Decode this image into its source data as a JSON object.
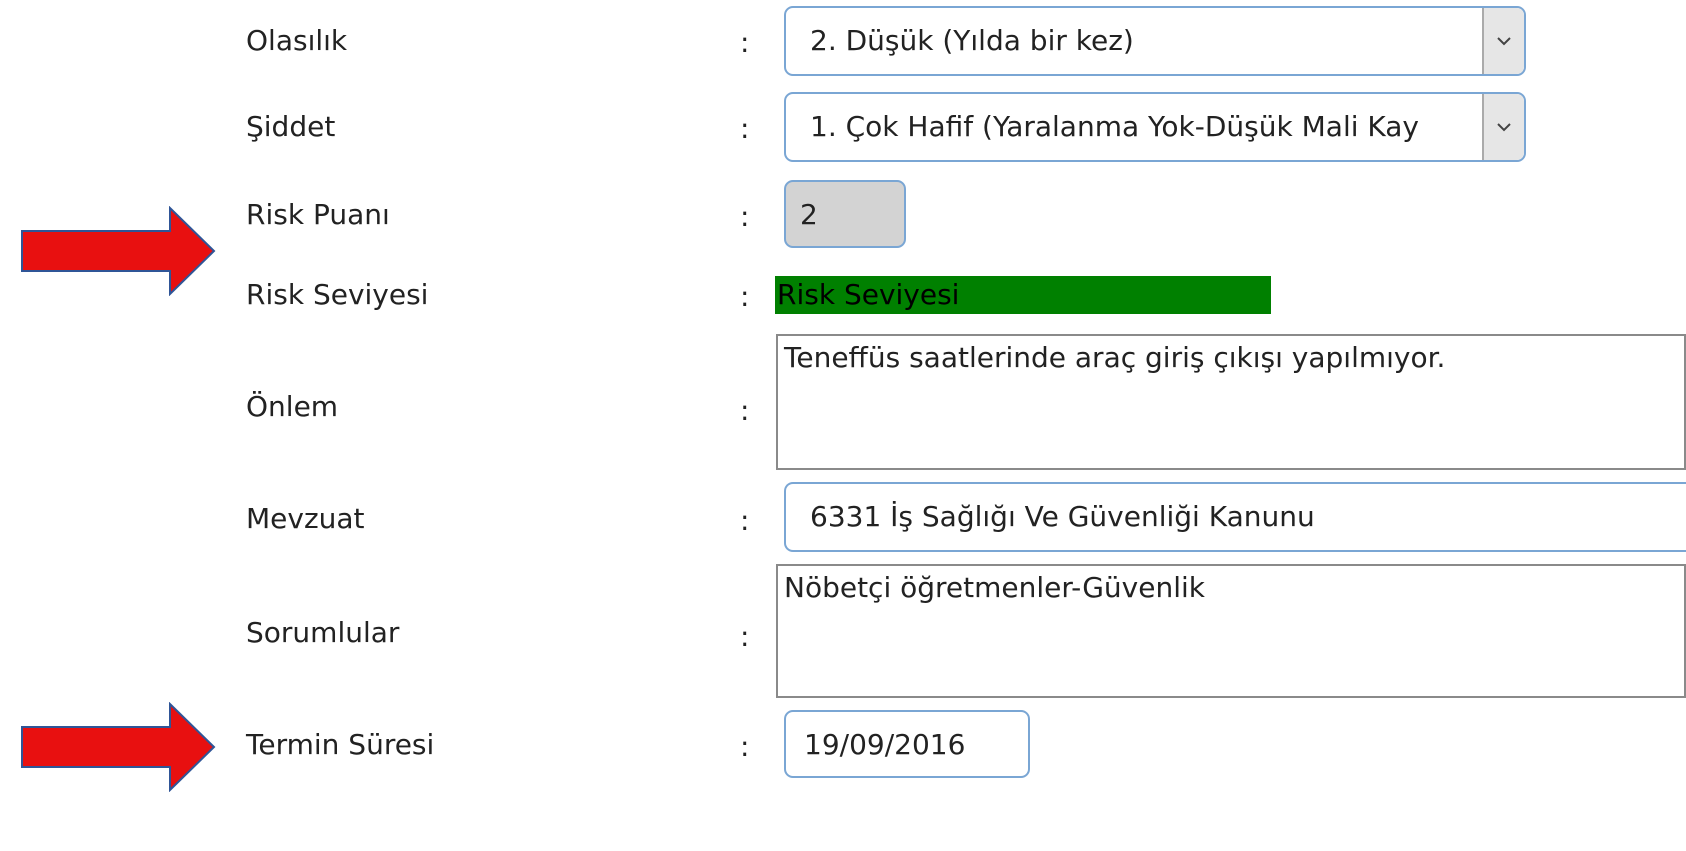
{
  "separator": ":",
  "fields": {
    "olasilik": {
      "label": "Olasılık",
      "selected": "2. Düşük (Yılda bir kez)"
    },
    "siddet": {
      "label": "Şiddet",
      "selected": "1. Çok Hafif (Yaralanma Yok-Düşük Mali Kay"
    },
    "risk_puani": {
      "label": "Risk Puanı",
      "value": "2"
    },
    "risk_seviyesi": {
      "label": "Risk Seviyesi",
      "value": "Risk Seviyesi",
      "color": "#008000"
    },
    "onlem": {
      "label": "Önlem",
      "value": "Teneffüs saatlerinde araç giriş çıkışı yapılmıyor."
    },
    "mevzuat": {
      "label": "Mevzuat",
      "value": "6331 İş Sağlığı Ve Güvenliği Kanunu"
    },
    "sorumlular": {
      "label": "Sorumlular",
      "value": "Nöbetçi öğretmenler-Güvenlik"
    },
    "termin_suresi": {
      "label": "Termin Süresi",
      "value": "19/09/2016"
    }
  },
  "annotations": {
    "arrow_color": "#e81010",
    "arrow_outline": "#2f5597"
  },
  "icons": {
    "dropdown": "chevron-down-icon",
    "annotation": "arrow-right-icon"
  }
}
